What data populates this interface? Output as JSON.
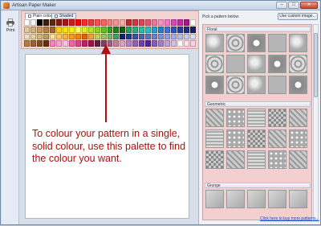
{
  "window": {
    "title": "Artisan Paper Maker"
  },
  "toolbar": {
    "print_label": "Print"
  },
  "palette": {
    "tabs": [
      {
        "label": "Plain colour",
        "active": true
      },
      {
        "label": "Shaded",
        "active": false
      }
    ],
    "rows": [
      [
        "#ffffff",
        "#f4f4f4",
        "#000000",
        "#3a1f0f",
        "#5a2a0a",
        "#8b1a0e",
        "#b01212",
        "#d01a1a",
        "#ff0000",
        "#ff2a2a",
        "#e83a3a",
        "#ff4d4d",
        "#ff6060",
        "#ff7878",
        "#ff9090",
        "#ffa8a8",
        "#c22a2a",
        "#d8343c",
        "#e84050",
        "#f05070",
        "#f870a0",
        "#ff90c0",
        "#ff70d0",
        "#e040c0",
        "#d020b0",
        "#b01090",
        "#ffffff"
      ],
      [
        "#e0c8a0",
        "#d8b080",
        "#c89860",
        "#b88040",
        "#a06828",
        "#ffd000",
        "#ffe000",
        "#fff000",
        "#ffff60",
        "#e0f020",
        "#c0e020",
        "#90d020",
        "#60c020",
        "#30a020",
        "#208020",
        "#0a6010",
        "#20a060",
        "#20b080",
        "#20c0a0",
        "#20c0c0",
        "#20a0d0",
        "#2080d0",
        "#4070e0",
        "#3050c0",
        "#2040a0",
        "#203080",
        "#102060"
      ],
      [
        "#f0e0c8",
        "#e8d0a0",
        "#d0b878",
        "#b8a060",
        "#ffe0a0",
        "#ffc860",
        "#ffb040",
        "#ff9820",
        "#ff8000",
        "#e86000",
        "#f0a040",
        "#c0d060",
        "#a0c060",
        "#80b060",
        "#40a060",
        "#10207a",
        "#1a3a9a",
        "#4050a0",
        "#5060b0",
        "#6070c0",
        "#7080c8",
        "#8090d0",
        "#90a0d8",
        "#a0b0e0",
        "#b0c0e8",
        "#c0d0f0",
        "#d0e0f8"
      ],
      [
        "#b08040",
        "#a06030",
        "#805020",
        "#603010",
        "#ff80c0",
        "#ffa0d0",
        "#ffc0e0",
        "#ff60a0",
        "#e04080",
        "#c02060",
        "#a01040",
        "#602040",
        "#804060",
        "#a06080",
        "#c080a0",
        "#e0a0c0",
        "#b080d0",
        "#9060c0",
        "#7040b0",
        "#5020a0",
        "#8060c0",
        "#a080d0",
        "#c0a0e0",
        "#d0c0f0",
        "#ffffff",
        "#ffe0f0",
        "#f8d0e8"
      ]
    ]
  },
  "annotation": {
    "text": "To colour your pattern in a single, solid colour, use this palette to find the colour you want."
  },
  "panel": {
    "pick_label": "Pick a pattern below:",
    "custom_button": "Use custom image...",
    "sections": [
      {
        "name": "Floral"
      },
      {
        "name": "Geometric"
      },
      {
        "name": "Grunge"
      }
    ],
    "buy_link": "Click here to buy more patterns..."
  },
  "colors": {
    "annotation": "#b01010",
    "arrow": "#b01010",
    "palette_bg": "#f3d4d0",
    "gallery_bg": "#f4cfcf"
  }
}
